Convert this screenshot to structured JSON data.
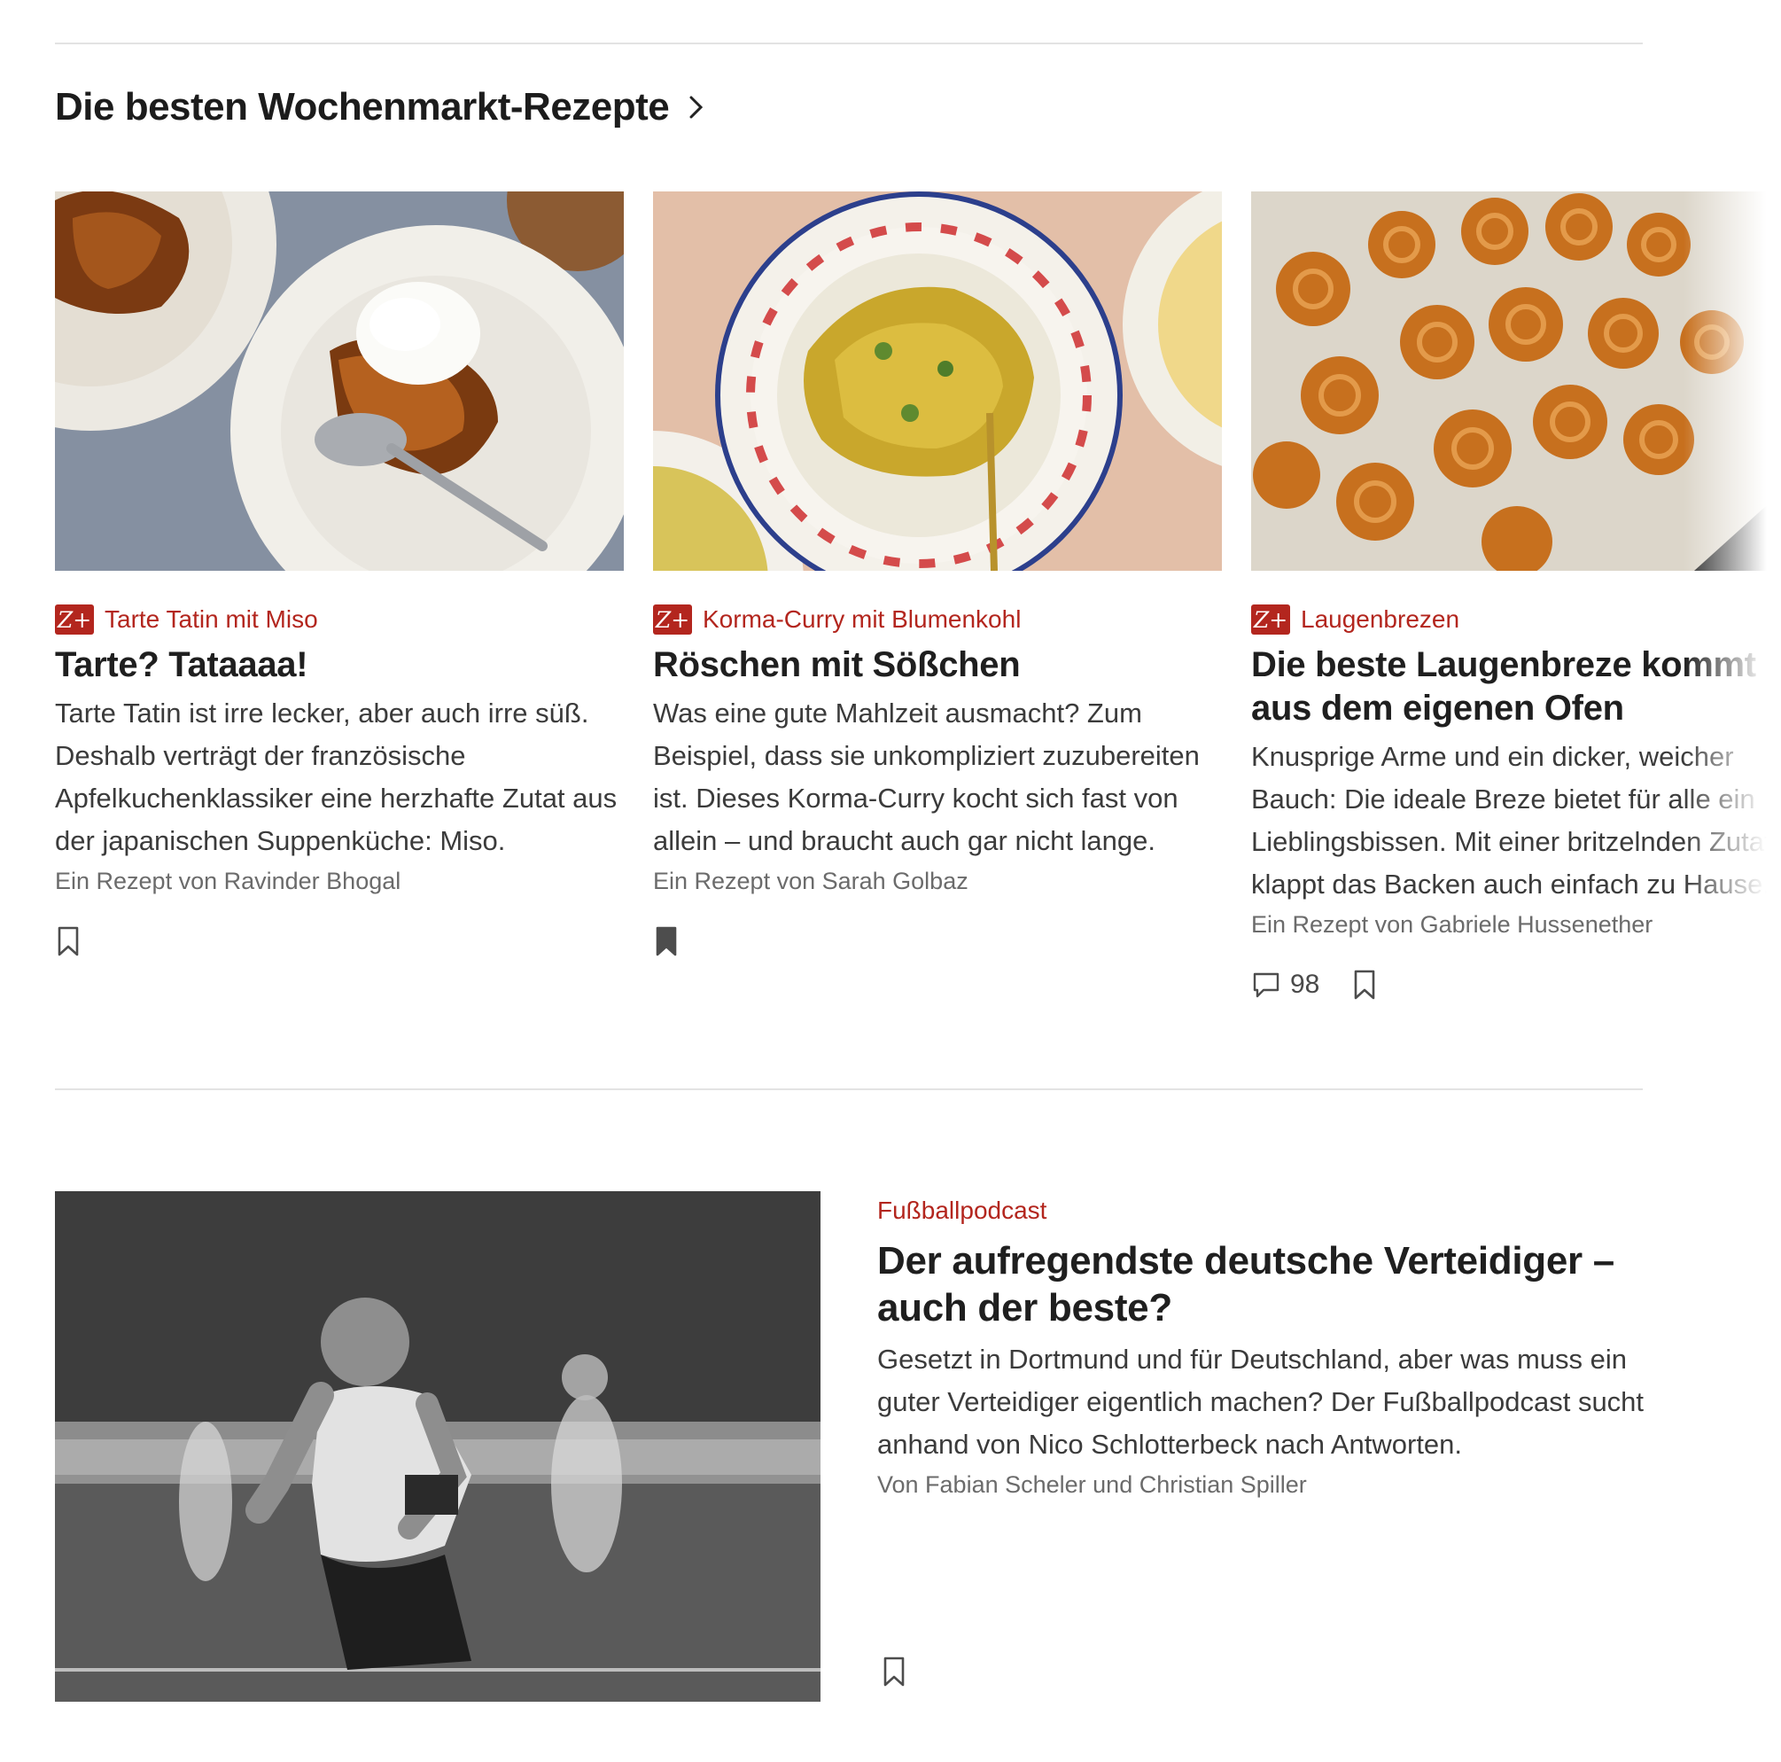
{
  "section": {
    "title": "Die besten Wochenmarkt-Rezepte",
    "badge": "Z+",
    "cards": [
      {
        "kicker": "Tarte Tatin mit Miso",
        "headline": "Tarte? Tataaaa!",
        "teaser": "Tarte Tatin ist irre lecker, aber auch irre süß. Deshalb verträgt der französische Apfelkuchenklassiker eine herzhafte Zutat aus der japanischen Suppenküche: Miso.",
        "author": "Ein Rezept von Ravinder Bhogal"
      },
      {
        "kicker": "Korma-Curry mit Blumenkohl",
        "headline": "Röschen mit Sößchen",
        "teaser": "Was eine gute Mahlzeit ausmacht? Zum Beispiel, dass sie unkompliziert zuzubereiten ist. Dieses Korma-Curry kocht sich fast von allein – und braucht auch gar nicht lange.",
        "author": "Ein Rezept von Sarah Golbaz"
      },
      {
        "kicker": "Laugenbrezen",
        "headline": "Die beste Laugenbreze kommt aus dem eigenen Ofen",
        "teaser": "Knusprige Arme und ein dicker, weicher Bauch: Die ideale Breze bietet für alle ein Lieblingsbissen. Mit einer britzelnden Zutat klappt das Backen auch einfach zu Hause.",
        "author": "Ein Rezept von Gabriele Hussenether",
        "comments": "98"
      }
    ]
  },
  "feature": {
    "kicker": "Fußballpodcast",
    "headline": "Der aufregendste deutsche Verteidiger – auch der beste?",
    "teaser": "Gesetzt in Dortmund und für Deutschland, aber was muss ein guter Verteidiger eigentlich machen? Der Fußballpodcast sucht anhand von Nico Schlotterbeck nach Antworten.",
    "author": "Von Fabian Scheler und Christian Spiller"
  },
  "colors": {
    "accent": "#b3261e",
    "rule": "#e3e3e3",
    "text": "#252525"
  },
  "icons": [
    "chevron-right-icon",
    "bookmark-icon",
    "bookmark-filled-icon",
    "comment-icon"
  ]
}
